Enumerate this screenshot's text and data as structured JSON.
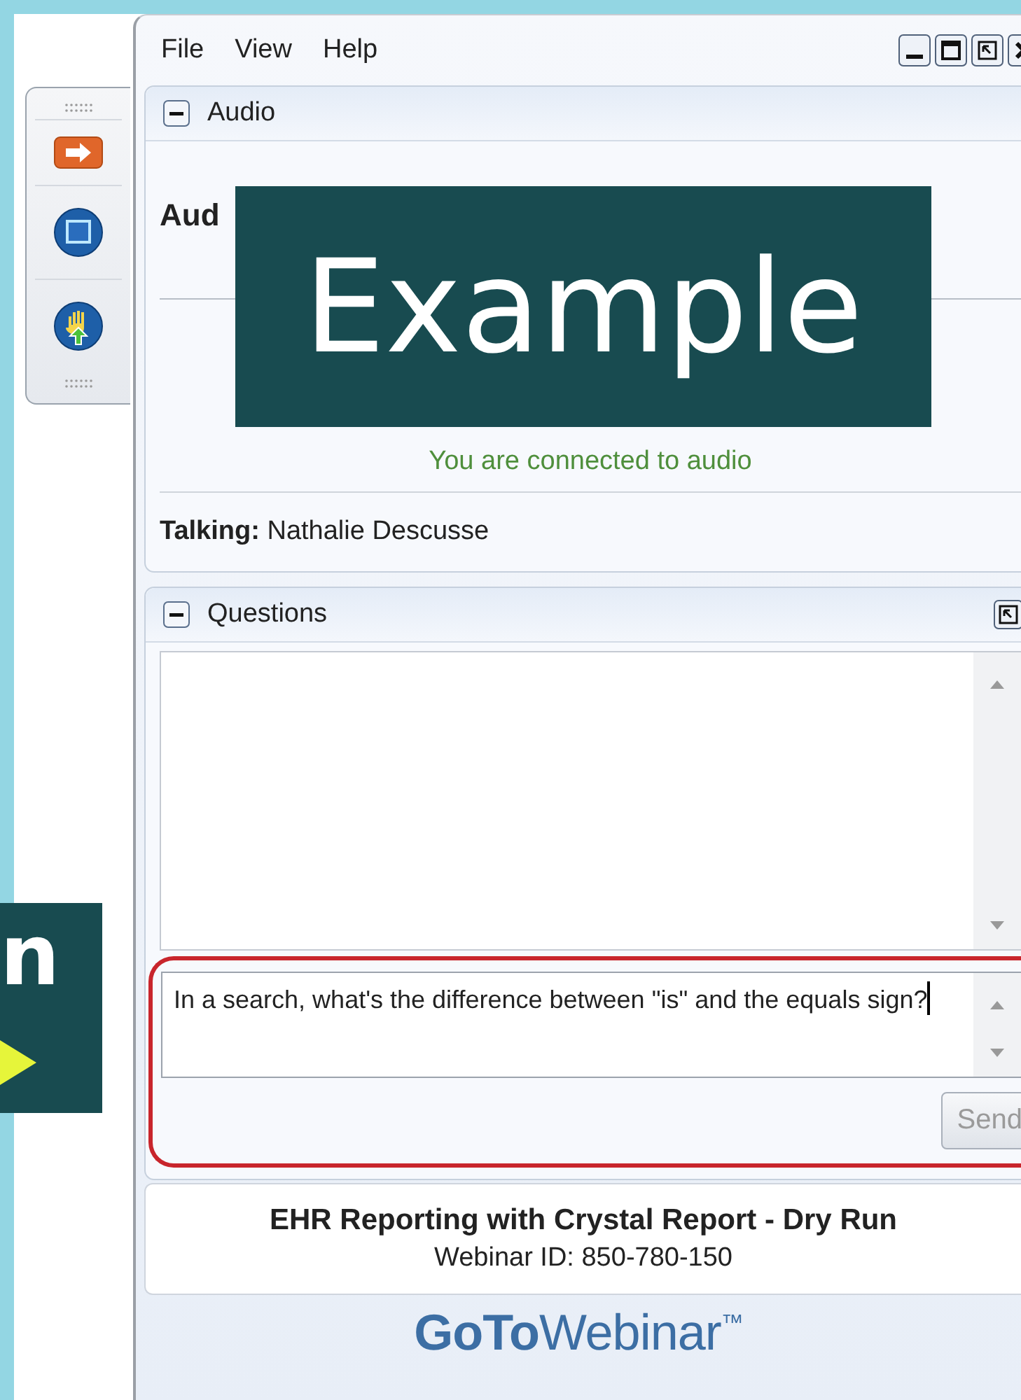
{
  "menu": [
    "File",
    "View",
    "Help"
  ],
  "audio_panel": {
    "title": "Audio",
    "expanded": true,
    "heading": "Aud",
    "status": "You are connected to audio",
    "talking": "**Talking:** Nathalie Descusse"
  },
  "questions_panel": {
    "title": "Questions",
    "expanded": true,
    "input": {
      "value": "In a search, what's the difference between \"is\" and the equals sign?",
      "highlighted": true
    },
    "send_button": {
      "label": "Send",
      "disabled": true
    }
  },
  "webinar": {
    "title": "EHR Reporting with Crystal Report - Dry Run",
    "id": "Webinar ID: 850-780-150"
  },
  "logo": "**GoTo**Webinar$^{™}$",
  "overlays": [
    {
      "kind": "label",
      "text": "Example"
    },
    {
      "kind": "pointer",
      "text": "n"
    }
  ]
}
